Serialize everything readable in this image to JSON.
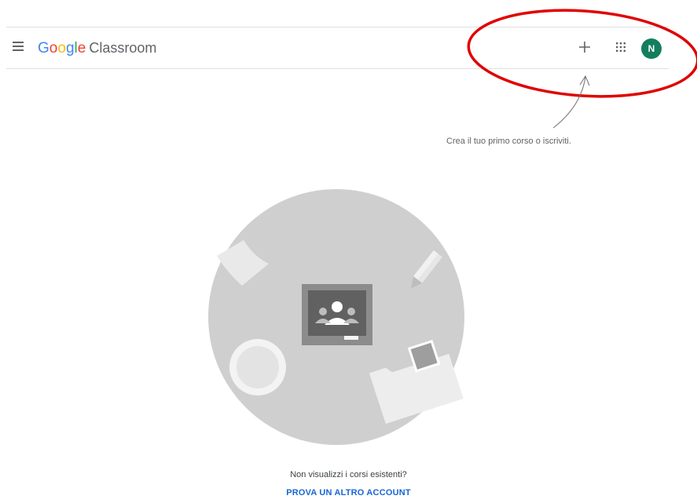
{
  "header": {
    "logo_letters": [
      "G",
      "o",
      "o",
      "g",
      "l",
      "e"
    ],
    "product_name": "Classroom",
    "avatar_initial": "N",
    "icons": [
      "menu-icon",
      "plus-icon",
      "apps-grid-icon"
    ]
  },
  "empty_state": {
    "hint_text": "Crea il tuo primo corso o iscriviti.",
    "question": "Non visualizzi i corsi esistenti?",
    "try_account_link": "PROVA UN ALTRO ACCOUNT"
  },
  "colors": {
    "google_blue": "#4285f4",
    "google_red": "#ea4335",
    "google_yellow": "#fbbc05",
    "google_green": "#34a853",
    "avatar_bg": "#137e5e",
    "link": "#1967d2",
    "annotation_red": "#e00000"
  }
}
